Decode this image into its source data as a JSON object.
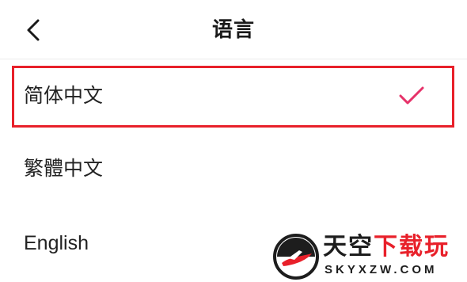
{
  "header": {
    "title": "语言",
    "back_icon": "chevron-left-icon"
  },
  "languages": [
    {
      "label": "简体中文",
      "selected": true
    },
    {
      "label": "繁體中文",
      "selected": false
    },
    {
      "label": "English",
      "selected": false
    }
  ],
  "selection": {
    "check_icon": "checkmark-icon",
    "check_color": "#e6336a",
    "highlight_color": "#e8202a"
  },
  "watermark": {
    "cn_dark": "天空",
    "cn_red": "下载玩",
    "en": "SKYXZW.COM"
  }
}
